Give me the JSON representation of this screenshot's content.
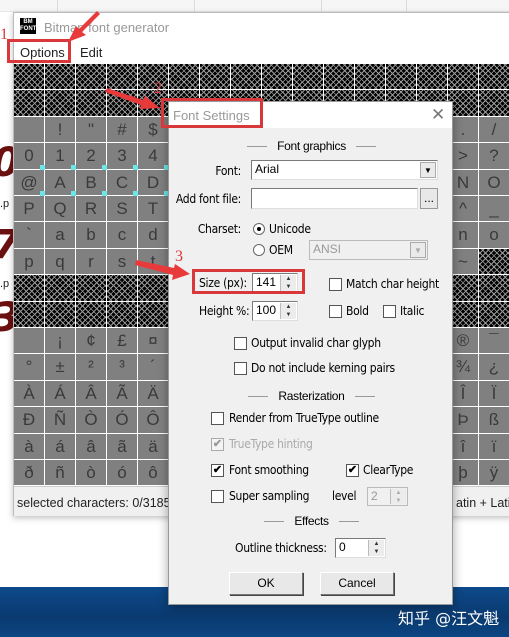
{
  "app": {
    "title": "Bitmap font generator",
    "icon": "bmfont-logo-icon",
    "icon_text": "BM FONT"
  },
  "menu": {
    "items": [
      "Options",
      "Edit"
    ]
  },
  "grid": {
    "rows": [
      {
        "type": "invalid"
      },
      {
        "type": "invalid"
      },
      {
        "left": [
          " ",
          "!",
          "\"",
          "#",
          "$"
        ],
        "right": [
          ".",
          "/"
        ]
      },
      {
        "left": [
          "0",
          "1",
          "2",
          "3",
          "4"
        ],
        "right": [
          ">",
          "?"
        ],
        "marked": true
      },
      {
        "left": [
          "@",
          "A",
          "B",
          "C",
          "D"
        ],
        "right": [
          "N",
          "O"
        ],
        "marked": true
      },
      {
        "left": [
          "P",
          "Q",
          "R",
          "S",
          "T"
        ],
        "right": [
          "^",
          "_"
        ]
      },
      {
        "left": [
          "`",
          "a",
          "b",
          "c",
          "d"
        ],
        "right": [
          "n",
          "o"
        ]
      },
      {
        "left": [
          "p",
          "q",
          "r",
          "s",
          "t"
        ],
        "right": [
          "~",
          null
        ]
      },
      {
        "type": "invalid"
      },
      {
        "type": "invalid"
      },
      {
        "left": [
          " ",
          "¡",
          "¢",
          "£",
          "¤"
        ],
        "right": [
          "®",
          "¯"
        ]
      },
      {
        "left": [
          "°",
          "±",
          "²",
          "³",
          "´"
        ],
        "right": [
          "¾",
          "¿"
        ]
      },
      {
        "left": [
          "À",
          "Á",
          "Â",
          "Ã",
          "Ä"
        ],
        "right": [
          "Î",
          "Ï"
        ]
      },
      {
        "left": [
          "Ð",
          "Ñ",
          "Ò",
          "Ó",
          "Ô"
        ],
        "right": [
          "Þ",
          "ß"
        ]
      },
      {
        "left": [
          "à",
          "á",
          "â",
          "ã",
          "ä"
        ],
        "right": [
          "î",
          "ï"
        ]
      },
      {
        "left": [
          "ð",
          "ñ",
          "ò",
          "ó",
          "ô"
        ],
        "right": [
          "þ",
          "ÿ"
        ]
      }
    ],
    "selection_marker_color": "#6ee6e6"
  },
  "status": {
    "left": "selected characters: 0/3185",
    "right": "atin + Lati"
  },
  "dialog": {
    "title": "Font Settings",
    "close_icon": "close-icon",
    "sections": {
      "font_graphics": "Font graphics",
      "rasterization": "Rasterization",
      "effects": "Effects"
    },
    "font": {
      "label": "Font:",
      "value": "Arial"
    },
    "add_font_file": {
      "label": "Add font file:",
      "value": "",
      "browse": "..."
    },
    "charset": {
      "label": "Charset:",
      "unicode": "Unicode",
      "oem": "OEM",
      "oem_value": "ANSI",
      "selected": "Unicode"
    },
    "size": {
      "label": "Size (px):",
      "value": "141"
    },
    "height": {
      "label": "Height %:",
      "value": "100"
    },
    "match_char_height": {
      "label": "Match char height",
      "checked": false
    },
    "bold": {
      "label": "Bold",
      "checked": false
    },
    "italic": {
      "label": "Italic",
      "checked": false
    },
    "output_invalid": {
      "label": "Output invalid char glyph",
      "checked": false
    },
    "no_kerning": {
      "label": "Do not include kerning pairs",
      "checked": false
    },
    "render_truetype": {
      "label": "Render from TrueType outline",
      "checked": false
    },
    "truetype_hinting": {
      "label": "TrueType hinting",
      "checked": true,
      "disabled": true
    },
    "font_smoothing": {
      "label": "Font smoothing",
      "checked": true
    },
    "cleartype": {
      "label": "ClearType",
      "checked": true
    },
    "super_sampling": {
      "label": "Super sampling",
      "checked": false
    },
    "level": {
      "label": "level",
      "value": "2"
    },
    "outline": {
      "label": "Outline thickness:",
      "value": "0"
    },
    "ok": "OK",
    "cancel": "Cancel"
  },
  "annotations": {
    "step1": "1",
    "step2": "2",
    "step3": "3",
    "color": "#d9383a"
  },
  "watermark": "知乎 @汪文魁"
}
